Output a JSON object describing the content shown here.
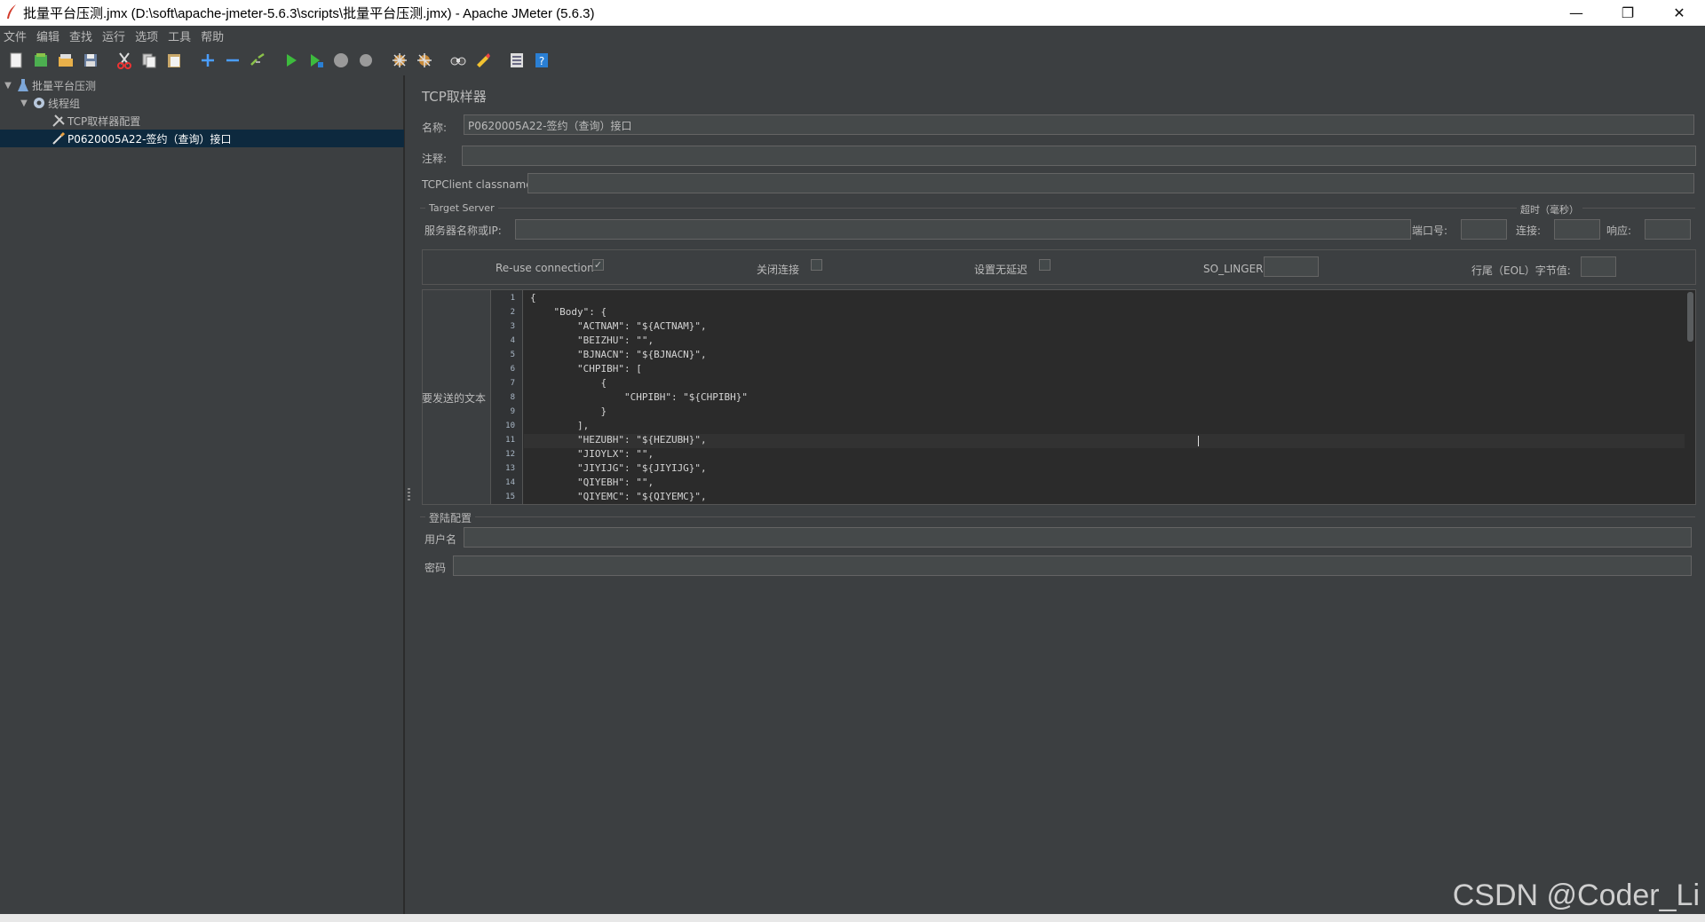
{
  "window": {
    "title": "批量平台压测.jmx (D:\\soft\\apache-jmeter-5.6.3\\scripts\\批量平台压测.jmx) - Apache JMeter (5.6.3)",
    "minimize": "—",
    "restore": "❐",
    "close": "✕"
  },
  "menu": [
    "文件",
    "编辑",
    "查找",
    "运行",
    "选项",
    "工具",
    "帮助"
  ],
  "toolbar": [
    "new-icon",
    "templates-icon",
    "open-icon",
    "save-icon",
    "cut-icon",
    "copy-icon",
    "paste-icon",
    "expand-icon",
    "collapse-icon",
    "toggle-icon",
    "start-icon",
    "start-no-pause-icon",
    "stop-icon",
    "shutdown-icon",
    "clear-icon",
    "clear-all-icon",
    "search-icon",
    "reset-search-icon",
    "function-helper-icon",
    "help-icon"
  ],
  "tree": {
    "root": "批量平台压测",
    "thread_group": "线程组",
    "config": "TCP取样器配置",
    "sampler": "P0620005A22-签约（查询）接口"
  },
  "sampler": {
    "panel_title": "TCP取样器",
    "name_label": "名称:",
    "name_value": "P0620005A22-签约（查询）接口",
    "comment_label": "注释:",
    "comment_value": "",
    "classname_label": "TCPClient classname:",
    "classname_value": "",
    "target_server_title": "Target Server",
    "timeout_title": "超时（毫秒）",
    "server_label": "服务器名称或IP:",
    "server_value": "",
    "port_label": "端口号:",
    "port_value": "",
    "connect_label": "连接:",
    "connect_value": "",
    "response_label": "响应:",
    "response_value": "",
    "reuse_label": "Re-use connection",
    "reuse_checked": "✓",
    "close_conn_label": "关闭连接",
    "nodelay_label": "设置无延迟",
    "solinger_label": "SO_LINGER:",
    "solinger_value": "",
    "eol_label": "行尾（EOL）字节值:",
    "eol_value": "",
    "text_label": "要发送的文本",
    "code_lines": [
      "{",
      "    \"Body\": {",
      "        \"ACTNAM\": \"${ACTNAM}\",",
      "        \"BEIZHU\": \"\",",
      "        \"BJNACN\": \"${BJNACN}\",",
      "        \"CHPIBH\": [",
      "            {",
      "                \"CHPIBH\": \"${CHPIBH}\"",
      "            }",
      "        ],",
      "        \"HEZUBH\": \"${HEZUBH}\",",
      "        \"JIOYLX\": \"\",",
      "        \"JIYIJG\": \"${JIYIJG}\",",
      "        \"QIYEBH\": \"\",",
      "        \"QIYEMC\": \"${QIYEMC}\","
    ],
    "line_numbers": [
      "1",
      "2",
      "3",
      "4",
      "5",
      "6",
      "7",
      "8",
      "9",
      "10",
      "11",
      "12",
      "13",
      "14",
      "15"
    ],
    "login_title": "登陆配置",
    "username_label": "用户名",
    "username_value": "",
    "password_label": "密码",
    "password_value": ""
  },
  "watermark": "CSDN @Coder_Li"
}
